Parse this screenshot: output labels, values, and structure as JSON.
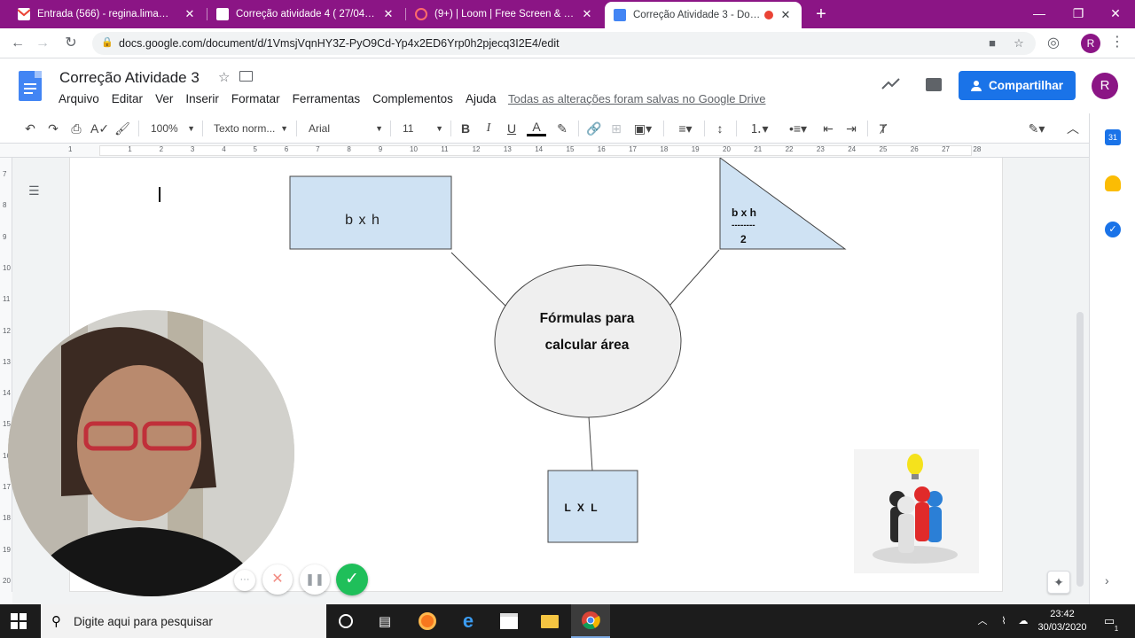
{
  "browser": {
    "tabs": [
      {
        "title": "Entrada (566) - regina.lima@pro...",
        "icon": "gmail-icon",
        "active": false
      },
      {
        "title": "Correção atividade 4 ( 27/04) - D...",
        "icon": "docs-icon",
        "active": false
      },
      {
        "title": "(9+) | Loom | Free Screen & Vide...",
        "icon": "loom-icon",
        "active": false
      },
      {
        "title": "Correção Atividade 3 - Docu...",
        "icon": "docs-icon",
        "active": true
      }
    ],
    "close_glyph": "✕",
    "new_tab_glyph": "+",
    "url": "docs.google.com/document/d/1VmsjVqnHY3Z-PyO9Cd-Yp4x2ED6Yrp0h2pjecq3I2E4/edit",
    "profile_initial": "R"
  },
  "docs": {
    "title": "Correção Atividade 3",
    "menu": [
      "Arquivo",
      "Editar",
      "Ver",
      "Inserir",
      "Formatar",
      "Ferramentas",
      "Complementos",
      "Ajuda"
    ],
    "save_status": "Todas as alterações foram salvas no Google Drive",
    "share_label": "Compartilhar",
    "avatar_initial": "R",
    "toolbar": {
      "zoom": "100%",
      "style": "Texto norm...",
      "font": "Arial",
      "size": "11"
    },
    "ruler_numbers": [
      "1",
      "1",
      "2",
      "3",
      "4",
      "5",
      "6",
      "7",
      "8",
      "9",
      "10",
      "11",
      "12",
      "13",
      "14",
      "15",
      "16",
      "17",
      "18",
      "19",
      "20",
      "21",
      "22",
      "23",
      "24",
      "25",
      "26",
      "27",
      "28"
    ],
    "vruler_numbers": [
      "7",
      "8",
      "9",
      "10",
      "11",
      "12",
      "13",
      "14",
      "15",
      "16",
      "17",
      "18",
      "19",
      "20"
    ]
  },
  "diagram": {
    "center_line1": "Fórmulas para",
    "center_line2": "calcular área",
    "rectangle_label": "b x h",
    "triangle_line1": "b x h",
    "triangle_line2": "--------",
    "triangle_line3": "2",
    "square_label": "L X L",
    "fill_blue": "#cfe2f3",
    "fill_gray": "#efefef"
  },
  "loom": {
    "more_glyph": "···",
    "cancel_glyph": "✕",
    "pause_glyph": "❚❚",
    "done_glyph": "✓",
    "done_color": "#1fbf5a",
    "cancel_color": "#f28b82"
  },
  "taskbar": {
    "search_placeholder": "Digite aqui para pesquisar",
    "time": "23:42",
    "date": "30/03/2020",
    "notification_count": "1"
  }
}
